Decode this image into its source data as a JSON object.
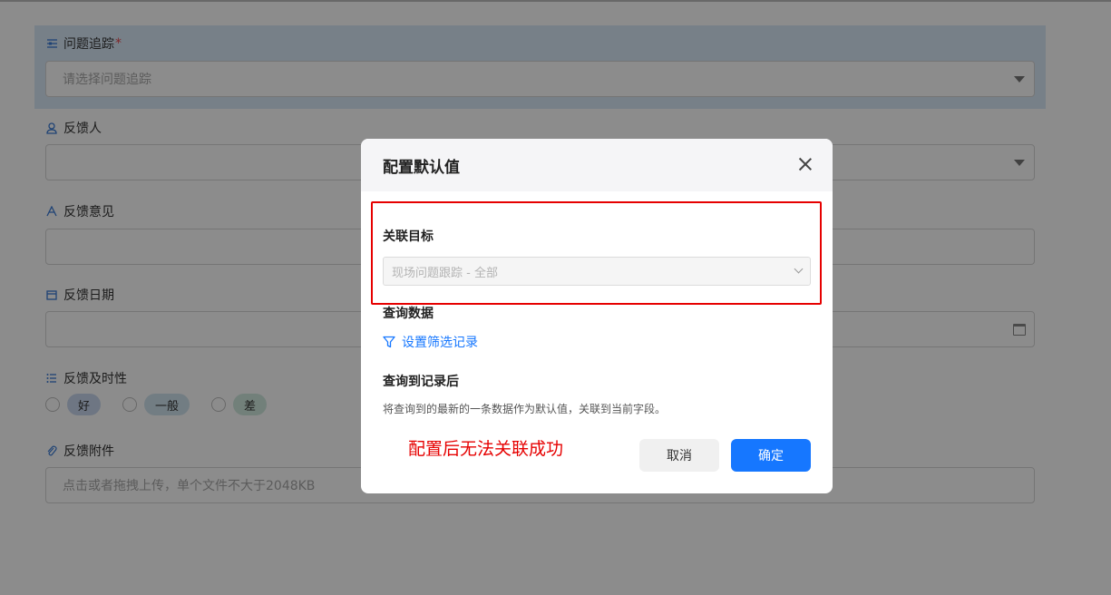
{
  "form": {
    "issue_tracking": {
      "label": "问题追踪",
      "required_mark": "*",
      "placeholder": "请选择问题追踪"
    },
    "feedback_person": {
      "label": "反馈人"
    },
    "feedback_opinion": {
      "label": "反馈意见"
    },
    "feedback_date": {
      "label": "反馈日期"
    },
    "feedback_timeliness": {
      "label": "反馈及时性",
      "options": [
        {
          "label": "好",
          "color": "#c9d8ee"
        },
        {
          "label": "一般",
          "color": "#cfe3ee"
        },
        {
          "label": "差",
          "color": "#cfe9df"
        }
      ]
    },
    "feedback_attachment": {
      "label": "反馈附件",
      "placeholder": "点击或者拖拽上传，单个文件不大于2048KB"
    }
  },
  "modal": {
    "title": "配置默认值",
    "link_target_title": "关联目标",
    "link_target_value": "现场问题跟踪 - 全部",
    "query_data_title": "查询数据",
    "filter_link": "设置筛选记录",
    "after_query_title": "查询到记录后",
    "after_query_desc": "将查询到的最新的一条数据作为默认值，关联到当前字段。",
    "annotation": "配置后无法关联成功",
    "cancel_label": "取消",
    "ok_label": "确定"
  },
  "colors": {
    "primary": "#1677ff",
    "annotation_red": "#e60000",
    "required": "#e5484d"
  }
}
